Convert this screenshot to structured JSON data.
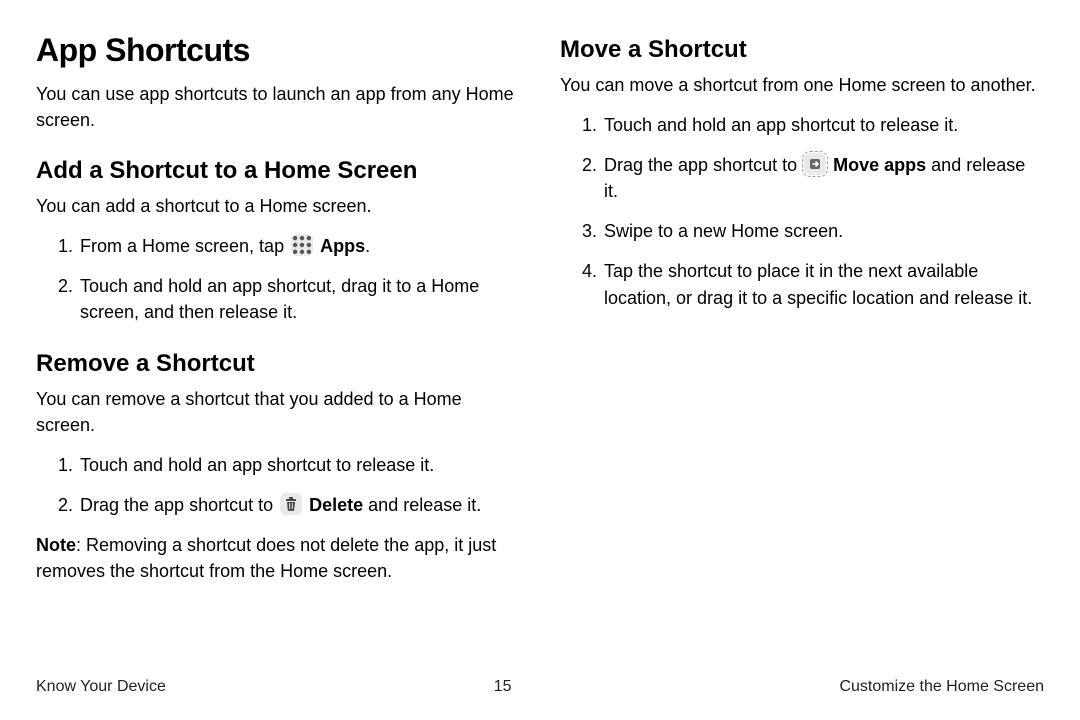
{
  "title": "App Shortcuts",
  "intro": "You can use app shortcuts to launch an app from any Home screen.",
  "add": {
    "heading": "Add a Shortcut to a Home Screen",
    "desc": "You can add a shortcut to a Home screen.",
    "step1_a": "From a Home screen, tap ",
    "step1_apps": "Apps",
    "step1_b": ".",
    "step2": "Touch and hold an app shortcut, drag it to a Home screen, and then release it."
  },
  "remove": {
    "heading": "Remove a Shortcut",
    "desc": "You can remove a shortcut that you added to a Home screen.",
    "step1": "Touch and hold an app shortcut to release it.",
    "step2_a": "Drag the app shortcut to ",
    "step2_delete": "Delete",
    "step2_b": " and release it.",
    "note_label": "Note",
    "note_body": ": Removing a shortcut does not delete the app, it just removes the shortcut from the Home screen."
  },
  "move": {
    "heading": "Move a Shortcut",
    "desc": "You can move a shortcut from one Home screen to another.",
    "step1": "Touch and hold an app shortcut to release it.",
    "step2_a": "Drag the app shortcut to ",
    "step2_move": "Move apps",
    "step2_b": " and release it.",
    "step3": "Swipe to a new Home screen.",
    "step4": "Tap the shortcut to place it in the next available location, or drag it to a specific location and release it."
  },
  "footer": {
    "left": "Know Your Device",
    "page": "15",
    "right": "Customize the Home Screen"
  },
  "icons": {
    "apps": "apps-grid-icon",
    "delete": "trash-icon",
    "move": "move-apps-icon"
  }
}
